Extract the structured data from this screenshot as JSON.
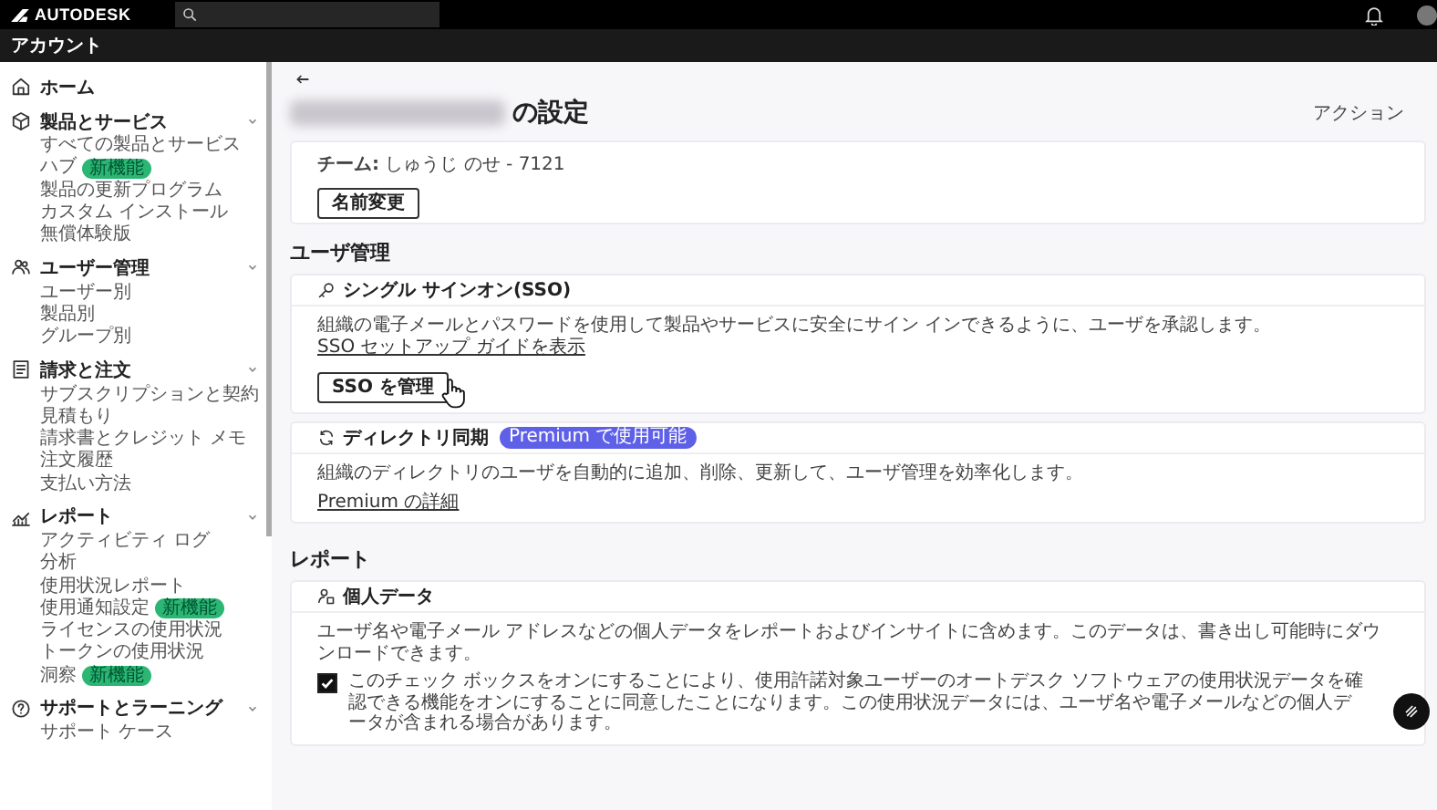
{
  "top_bar": {
    "brand": "AUTODESK"
  },
  "sub_bar": {
    "title": "アカウント"
  },
  "sidebar": {
    "sections": [
      {
        "label": "ホーム"
      },
      {
        "label": "製品とサービス",
        "children": [
          {
            "label": "すべての製品とサービス"
          },
          {
            "label": "ハブ",
            "badge": "新機能"
          },
          {
            "label": "製品の更新プログラム"
          },
          {
            "label": "カスタム インストール"
          },
          {
            "label": "無償体験版"
          }
        ]
      },
      {
        "label": "ユーザー管理",
        "children": [
          {
            "label": "ユーザー別"
          },
          {
            "label": "製品別"
          },
          {
            "label": "グループ別"
          }
        ]
      },
      {
        "label": "請求と注文",
        "children": [
          {
            "label": "サブスクリプションと契約"
          },
          {
            "label": "見積もり"
          },
          {
            "label": "請求書とクレジット メモ"
          },
          {
            "label": "注文履歴"
          },
          {
            "label": "支払い方法"
          }
        ]
      },
      {
        "label": "レポート",
        "children": [
          {
            "label": "アクティビティ ログ"
          },
          {
            "label": "分析"
          },
          {
            "label": "使用状況レポート"
          },
          {
            "label": "使用通知設定",
            "badge": "新機能"
          },
          {
            "label": "ライセンスの使用状況"
          },
          {
            "label": "トークンの使用状況"
          },
          {
            "label": "洞察",
            "badge": "新機能"
          }
        ]
      },
      {
        "label": "サポートとラーニング",
        "children": [
          {
            "label": "サポート ケース"
          }
        ]
      }
    ]
  },
  "page": {
    "title_suffix": "の設定",
    "actions": "アクション",
    "team_card": {
      "label": "チーム:",
      "value": "しゅうじ のせ - 7121",
      "button": "名前変更"
    },
    "sections": [
      {
        "heading": "ユーザ管理",
        "cards": [
          {
            "title": "シングル サインオン(SSO)",
            "description": "組織の電子メールとパスワードを使用して製品やサービスに安全にサイン インできるように、ユーザを承認します。",
            "link": "SSO セットアップ ガイドを表示",
            "button": "SSO を管理"
          },
          {
            "title": "ディレクトリ同期",
            "badge": "Premium で使用可能",
            "description": "組織のディレクトリのユーザを自動的に追加、削除、更新して、ユーザ管理を効率化します。",
            "link": "Premium の詳細"
          }
        ]
      },
      {
        "heading": "レポート",
        "cards": [
          {
            "title": "個人データ",
            "description": "ユーザ名や電子メール アドレスなどの個人データをレポートおよびインサイトに含めます。このデータは、書き出し可能時にダウンロードできます。",
            "checkbox": {
              "checked": true,
              "label": "このチェック ボックスをオンにすることにより、使用許諾対象ユーザーのオートデスク ソフトウェアの使用状況データを確認できる機能をオンにすることに同意したことになります。この使用状況データには、ユーザ名や電子メールなどの個人データが含まれる場合があります。"
            }
          }
        ]
      }
    ]
  }
}
